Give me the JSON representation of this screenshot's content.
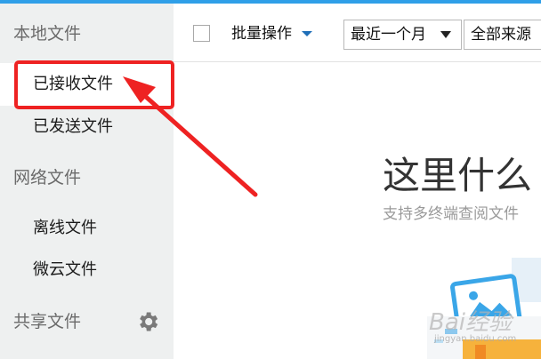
{
  "sidebar": {
    "sections": [
      {
        "label": "本地文件",
        "items": [
          "已接收文件",
          "已发送文件"
        ]
      },
      {
        "label": "网络文件",
        "items": [
          "离线文件",
          "微云文件"
        ]
      },
      {
        "label": "共享文件",
        "items": []
      }
    ],
    "selected_item": "已接收文件",
    "settings_icon": "gear-icon"
  },
  "toolbar": {
    "batch_label": "批量操作",
    "time_filter": "最近一个月",
    "source_filter": "全部来源"
  },
  "empty_state": {
    "title": "这里什么",
    "subtitle": "支持多终端查阅文件"
  },
  "watermark": {
    "text": "Bai经验",
    "sub": "jingyan.baidu.com"
  },
  "colors": {
    "accent": "#2f9fe8",
    "annotation": "#ee2222",
    "sidebar_bg": "#eef0f0"
  }
}
